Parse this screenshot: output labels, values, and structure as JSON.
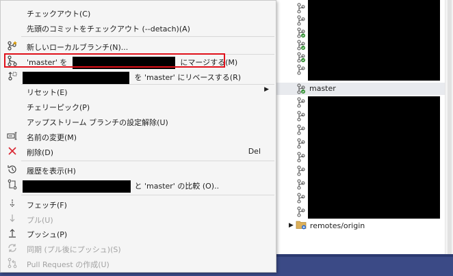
{
  "menu": {
    "items": [
      {
        "id": "checkout",
        "label": "チェックアウト(C)",
        "icon": "none"
      },
      {
        "id": "checkout-detach",
        "label": "先頭のコミットをチェックアウト (--detach)(A)",
        "icon": "none"
      },
      {
        "id": "new-branch",
        "label": "新しいローカルブランチ(N)...",
        "icon": "new-branch-icon"
      },
      {
        "id": "merge",
        "label_prefix": "'master' を",
        "label_suffix": "にマージする(M)",
        "icon": "merge-icon"
      },
      {
        "id": "rebase",
        "label_suffix": "を 'master' にリベースする(R)",
        "icon": "rebase-icon"
      },
      {
        "id": "reset",
        "label": "リセット(E)",
        "icon": "none",
        "submenu": true
      },
      {
        "id": "cherry-pick",
        "label": "チェリーピック(P)",
        "icon": "none"
      },
      {
        "id": "unset-upstream",
        "label": "アップストリーム ブランチの設定解除(U)",
        "icon": "none"
      },
      {
        "id": "rename",
        "label": "名前の変更(M)",
        "icon": "rename-icon"
      },
      {
        "id": "delete",
        "label": "削除(D)",
        "shortcut": "Del",
        "icon": "delete-icon"
      },
      {
        "id": "history",
        "label": "履歴を表示(H)",
        "icon": "history-icon"
      },
      {
        "id": "compare",
        "label_suffix": "と 'master' の比較 (O)..",
        "icon": "compare-icon"
      },
      {
        "id": "fetch",
        "label": "フェッチ(F)",
        "icon": "fetch-icon"
      },
      {
        "id": "pull",
        "label": "プル(U)",
        "icon": "pull-icon",
        "disabled": true
      },
      {
        "id": "push",
        "label": "プッシュ(P)",
        "icon": "push-icon"
      },
      {
        "id": "sync",
        "label": "同期 (プル後にプッシュ)(S)",
        "icon": "sync-icon",
        "disabled": true
      },
      {
        "id": "pull-request",
        "label": "Pull Request の作成(U)",
        "icon": "pull-request-icon",
        "disabled": true
      }
    ]
  },
  "tree": {
    "selected_branch": "master",
    "remotes_label": "remotes/origin"
  },
  "colors": {
    "highlight_border": "#e0101a",
    "menu_bg": "#f5f5f5",
    "delete_icon": "#d9232e",
    "bottom_bar": "#3b4a86"
  }
}
